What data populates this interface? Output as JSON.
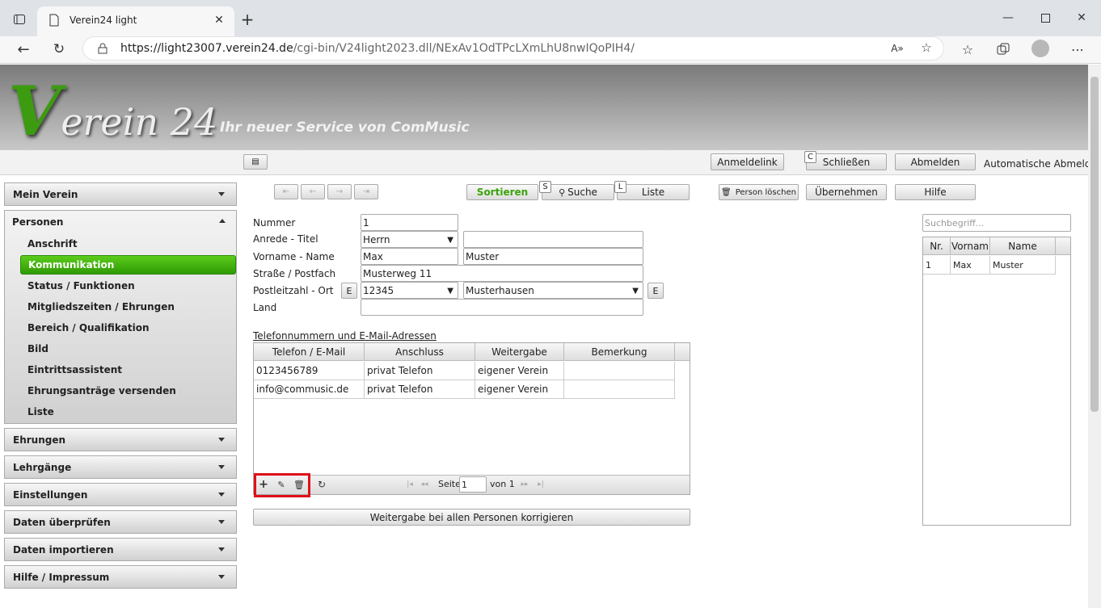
{
  "browser": {
    "tab_title": "Verein24 light",
    "url_host": "https://light23007.verein24.de",
    "url_path": "/cgi-bin/V24light2023.dll/NExAv1OdTPcLXmLhU8nwIQoPIH4/"
  },
  "banner": {
    "logo_v": "V",
    "logo_rest": "erein 24",
    "slogan": "Ihr neuer Service von ComMusic"
  },
  "topbar": {
    "menu_icon": "list-icon",
    "anmeldelink": "Anmeldelink",
    "schliessen_key": "C",
    "schliessen": "Schließen",
    "abmelden": "Abmelden",
    "auto_logout": "Automatische Abmeldung"
  },
  "sidebar": {
    "groups": [
      {
        "label": "Mein Verein"
      },
      {
        "label": "Personen"
      },
      {
        "label": "Ehrungen"
      },
      {
        "label": "Lehrgänge"
      },
      {
        "label": "Einstellungen"
      },
      {
        "label": "Daten überprüfen"
      },
      {
        "label": "Daten importieren"
      },
      {
        "label": "Hilfe / Impressum"
      }
    ],
    "personen_items": [
      "Anschrift",
      "Kommunikation",
      "Status / Funktionen",
      "Mitgliedszeiten / Ehrungen",
      "Bereich / Qualifikation",
      "Bild",
      "Eintrittsassistent",
      "Ehrungsanträge versenden",
      "Liste"
    ],
    "active_item": "Kommunikation",
    "active_color": "#3aa30a"
  },
  "toolbar": {
    "sortieren": "Sortieren",
    "sortieren_color": "#3aa30a",
    "suche_key": "S",
    "suche": "Suche",
    "liste_key": "L",
    "liste": "Liste",
    "person_loeschen": "Person löschen",
    "uebernehmen": "Übernehmen",
    "hilfe": "Hilfe"
  },
  "form": {
    "nummer_label": "Nummer",
    "nummer": "1",
    "anrede_label": "Anrede - Titel",
    "anrede": "Herrn",
    "titel": "",
    "name_label": "Vorname - Name",
    "vorname": "Max",
    "nachname": "Muster",
    "strasse_label": "Straße / Postfach",
    "strasse": "Musterweg 11",
    "plz_label": "Postleitzahl - Ort",
    "plz": "12345",
    "ort": "Musterhausen",
    "edit_btn": "E",
    "land_label": "Land",
    "land": ""
  },
  "phones": {
    "section_title": "Telefonnummern und E-Mail-Adressen",
    "columns": [
      "Telefon / E-Mail",
      "Anschluss",
      "Weitergabe",
      "Bemerkung"
    ],
    "rows": [
      [
        "0123456789",
        "privat Telefon",
        "eigener Verein",
        ""
      ],
      [
        "info@commusic.de",
        "privat Telefon",
        "eigener Verein",
        ""
      ]
    ],
    "pager": {
      "seite_label": "Seite",
      "page": "1",
      "von": "von 1"
    },
    "fix_button": "Weitergabe bei allen Personen korrigieren"
  },
  "search": {
    "placeholder": "Suchbegriff...",
    "columns": [
      "Nr.",
      "Vornam",
      "Name"
    ],
    "rows": [
      [
        "1",
        "Max",
        "Muster"
      ]
    ]
  }
}
